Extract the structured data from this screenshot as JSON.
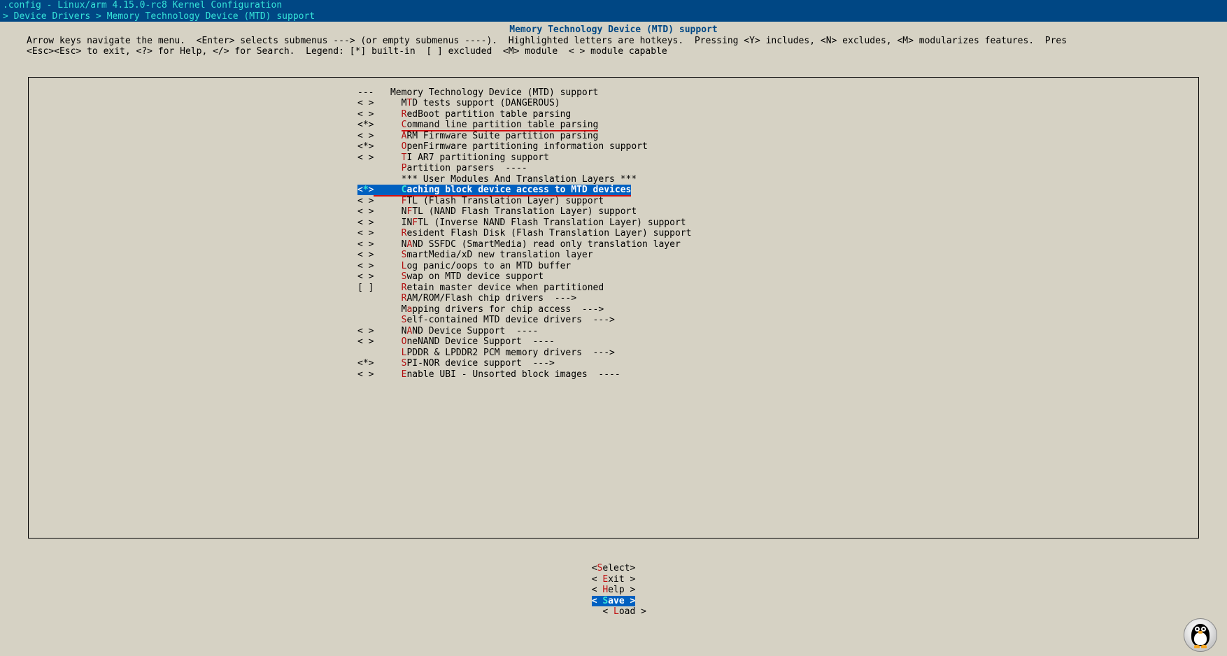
{
  "topbar": {
    "line1": ".config - Linux/arm 4.15.0-rc8 Kernel Configuration",
    "line2": "> Device Drivers > Memory Technology Device (MTD) support"
  },
  "title": "Memory Technology Device (MTD) support",
  "help": {
    "line1": "Arrow keys navigate the menu.  <Enter> selects submenus ---> (or empty submenus ----).  Highlighted letters are hotkeys.  Pressing <Y> includes, <N> excludes, <M> modularizes features.  Pres",
    "line2": "<Esc><Esc> to exit, <?> for Help, </> for Search.  Legend: [*] built-in  [ ] excluded  <M> module  < > module capable"
  },
  "menu": [
    {
      "bracket": "---",
      "hot": "",
      "text": "Memory Technology Device (MTD) support",
      "sel": false,
      "und": false,
      "spacer": "   "
    },
    {
      "bracket": "< >",
      "hot": "T",
      "pre": "M",
      "text": "D tests support (DANGEROUS)",
      "sel": false,
      "und": false,
      "spacer": "     "
    },
    {
      "bracket": "< >",
      "hot": "R",
      "pre": "",
      "text": "edBoot partition table parsing",
      "sel": false,
      "und": false,
      "spacer": "     "
    },
    {
      "bracket": "<*>",
      "hot": "C",
      "pre": "",
      "text": "ommand line partition table parsing",
      "sel": false,
      "und": true,
      "spacer": "     "
    },
    {
      "bracket": "< >",
      "hot": "A",
      "pre": "",
      "text": "RM Firmware Suite partition parsing",
      "sel": false,
      "und": false,
      "spacer": "     "
    },
    {
      "bracket": "<*>",
      "hot": "O",
      "pre": "",
      "text": "penFirmware partitioning information support",
      "sel": false,
      "und": false,
      "spacer": "     "
    },
    {
      "bracket": "< >",
      "hot": "T",
      "pre": "",
      "text": "I AR7 partitioning support",
      "sel": false,
      "und": false,
      "spacer": "     "
    },
    {
      "bracket": "   ",
      "hot": "P",
      "pre": "",
      "text": "artition parsers  ----",
      "sel": false,
      "und": false,
      "spacer": "     "
    },
    {
      "bracket": "   ",
      "hot": "",
      "pre": "",
      "text": "*** User Modules And Translation Layers ***",
      "sel": false,
      "und": false,
      "spacer": "     "
    },
    {
      "bracket": "<*>",
      "hot": "C",
      "pre": "",
      "text": "aching block device access to MTD devices",
      "sel": true,
      "und": true,
      "spacer": "     "
    },
    {
      "bracket": "< >",
      "hot": "F",
      "pre": "",
      "text": "TL (Flash Translation Layer) support",
      "sel": false,
      "und": false,
      "spacer": "     "
    },
    {
      "bracket": "< >",
      "hot": "F",
      "pre": "N",
      "text": "TL (NAND Flash Translation Layer) support",
      "sel": false,
      "und": false,
      "spacer": "     "
    },
    {
      "bracket": "< >",
      "hot": "F",
      "pre": "IN",
      "text": "TL (Inverse NAND Flash Translation Layer) support",
      "sel": false,
      "und": false,
      "spacer": "     "
    },
    {
      "bracket": "< >",
      "hot": "R",
      "pre": "",
      "text": "esident Flash Disk (Flash Translation Layer) support",
      "sel": false,
      "und": false,
      "spacer": "     "
    },
    {
      "bracket": "< >",
      "hot": "A",
      "pre": "N",
      "text": "ND SSFDC (SmartMedia) read only translation layer",
      "sel": false,
      "und": false,
      "spacer": "     "
    },
    {
      "bracket": "< >",
      "hot": "S",
      "pre": "",
      "text": "martMedia/xD new translation layer",
      "sel": false,
      "und": false,
      "spacer": "     "
    },
    {
      "bracket": "< >",
      "hot": "L",
      "pre": "",
      "text": "og panic/oops to an MTD buffer",
      "sel": false,
      "und": false,
      "spacer": "     "
    },
    {
      "bracket": "< >",
      "hot": "S",
      "pre": "",
      "text": "wap on MTD device support",
      "sel": false,
      "und": false,
      "spacer": "     "
    },
    {
      "bracket": "[ ]",
      "hot": "R",
      "pre": "",
      "text": "etain master device when partitioned",
      "sel": false,
      "und": false,
      "spacer": "     "
    },
    {
      "bracket": "   ",
      "hot": "R",
      "pre": "",
      "text": "AM/ROM/Flash chip drivers  --->",
      "sel": false,
      "und": false,
      "spacer": "     "
    },
    {
      "bracket": "   ",
      "hot": "a",
      "pre": "M",
      "text": "pping drivers for chip access  --->",
      "sel": false,
      "und": false,
      "spacer": "     "
    },
    {
      "bracket": "   ",
      "hot": "S",
      "pre": "",
      "text": "elf-contained MTD device drivers  --->",
      "sel": false,
      "und": false,
      "spacer": "     "
    },
    {
      "bracket": "< >",
      "hot": "A",
      "pre": "N",
      "text": "ND Device Support  ----",
      "sel": false,
      "und": false,
      "spacer": "     "
    },
    {
      "bracket": "< >",
      "hot": "O",
      "pre": "",
      "text": "neNAND Device Support  ----",
      "sel": false,
      "und": false,
      "spacer": "     "
    },
    {
      "bracket": "   ",
      "hot": "L",
      "pre": "",
      "text": "PDDR & LPDDR2 PCM memory drivers  --->",
      "sel": false,
      "und": false,
      "spacer": "     "
    },
    {
      "bracket": "<*>",
      "hot": "S",
      "pre": "",
      "text": "PI-NOR device support  --->",
      "sel": false,
      "und": false,
      "spacer": "     "
    },
    {
      "bracket": "< >",
      "hot": "E",
      "pre": "",
      "text": "nable UBI - Unsorted block images  ----",
      "sel": false,
      "und": false,
      "spacer": "     "
    }
  ],
  "buttons": {
    "select": {
      "pre": "<",
      "key": "S",
      "text": "elect>"
    },
    "exit": {
      "pre": "< ",
      "key": "E",
      "text": "xit >"
    },
    "help": {
      "pre": "< ",
      "key": "H",
      "text": "elp >"
    },
    "save": {
      "pre": "< ",
      "key": "S",
      "text": "ave >"
    },
    "load": {
      "pre": "< ",
      "key": "L",
      "text": "oad >"
    }
  }
}
